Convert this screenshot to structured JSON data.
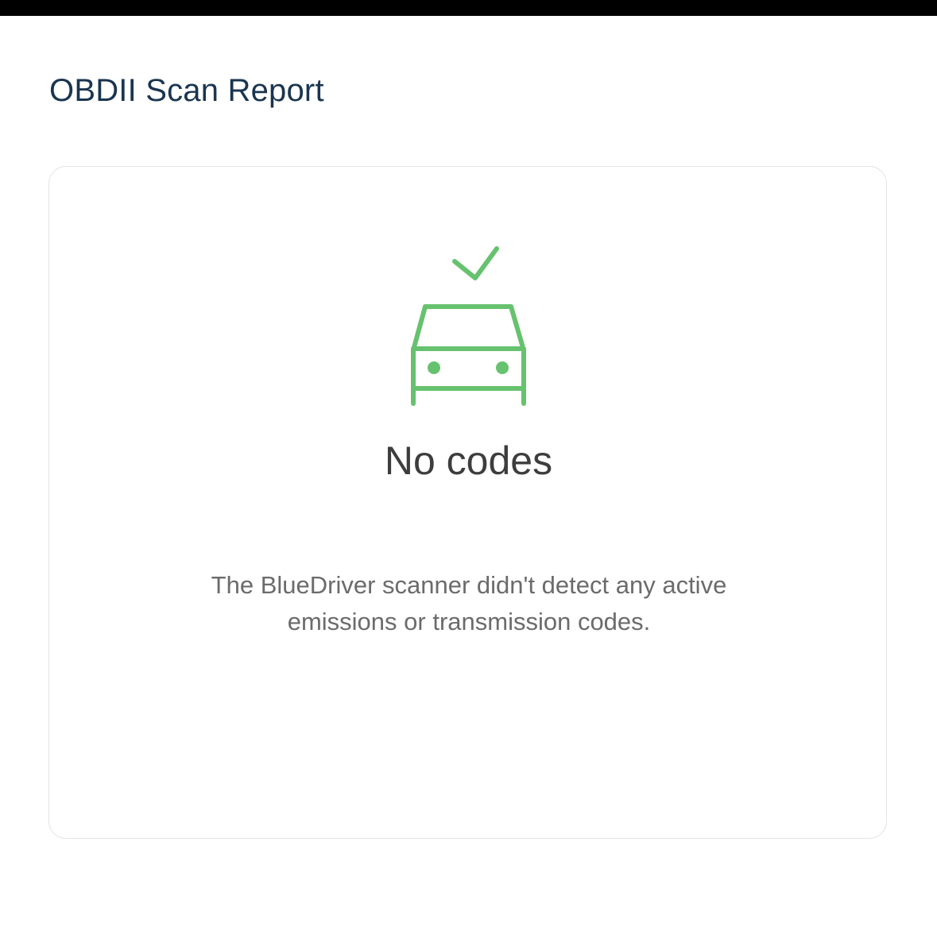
{
  "header": {
    "title": "OBDII Scan Report"
  },
  "result_card": {
    "icons": [
      "checkmark-icon",
      "car-icon"
    ],
    "status_title": "No codes",
    "status_message": "The BlueDriver scanner didn't detect any active emissions or transmission codes."
  },
  "colors": {
    "accent_green": "#66c26e",
    "title_color": "#1a3550",
    "status_title_color": "#3d3d3d",
    "message_color": "#6b6b6b",
    "card_border": "#e3e3e3"
  }
}
